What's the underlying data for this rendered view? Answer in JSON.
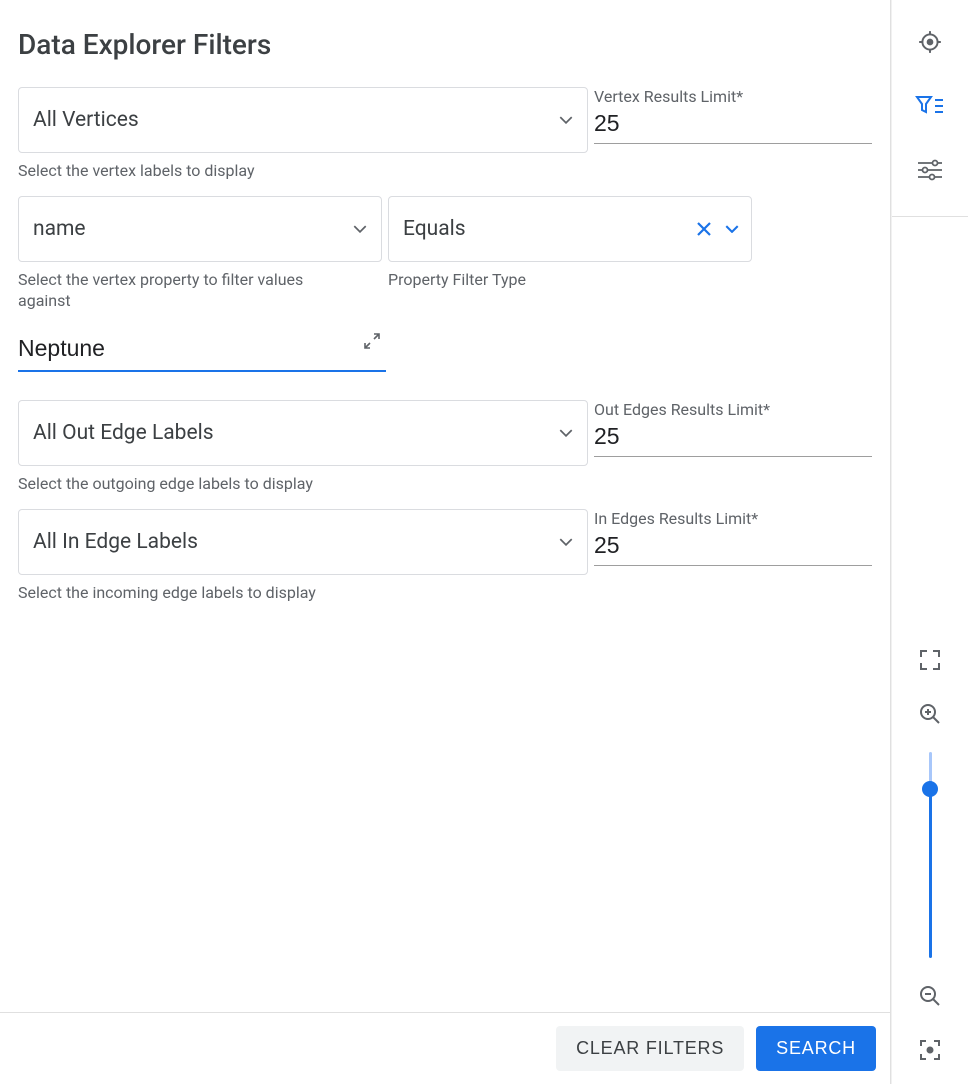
{
  "title": "Data Explorer Filters",
  "vertex": {
    "select_label": "All Vertices",
    "helper": "Select the vertex labels to display",
    "limit_label": "Vertex Results Limit*",
    "limit_value": "25"
  },
  "property": {
    "select_label": "name",
    "helper": "Select the vertex property to filter values against",
    "filter_type_label": "Equals",
    "filter_type_helper": "Property Filter Type",
    "value": "Neptune"
  },
  "out_edges": {
    "select_label": "All Out Edge Labels",
    "helper": "Select the outgoing edge labels to display",
    "limit_label": "Out Edges Results Limit*",
    "limit_value": "25"
  },
  "in_edges": {
    "select_label": "All In Edge Labels",
    "helper": "Select the incoming edge labels to display",
    "limit_label": "In Edges Results Limit*",
    "limit_value": "25"
  },
  "buttons": {
    "clear": "CLEAR FILTERS",
    "search": "SEARCH"
  }
}
